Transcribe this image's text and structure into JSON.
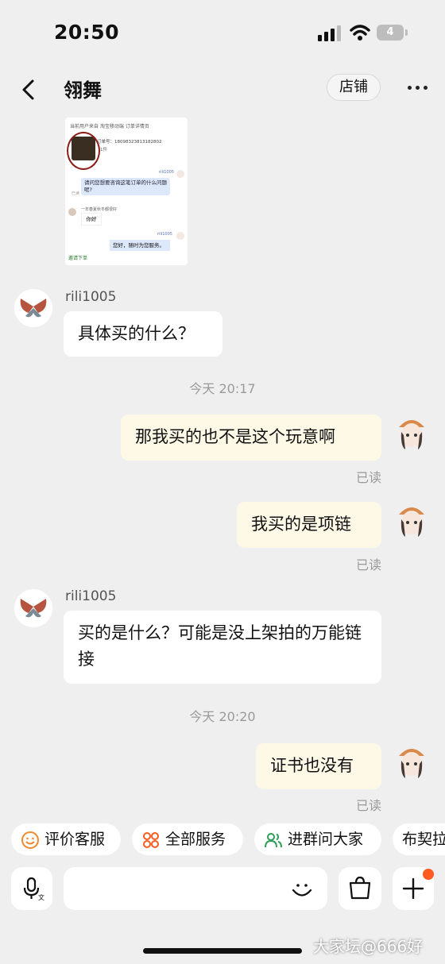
{
  "status_bar": {
    "time": "20:50",
    "battery": "4"
  },
  "header": {
    "title": "翎舞",
    "shop_label": "店铺"
  },
  "screenshot_preview": {
    "top_line": "当前用户来自 淘宝移动端 订单详情页",
    "order_line": "订单号：1809832381318280​2",
    "qty": "1件",
    "agent_name": "rili1005",
    "agent_question": "请问您想要咨询这笔订单的什么问题呢?",
    "read_label": "已读",
    "customer_name": "一年春夏秋冬都很好",
    "customer_msg": "你好",
    "agent_reply": "您好，随时为您服务。",
    "bottom_link": "邀请下单"
  },
  "messages": [
    {
      "sender": "rili1005",
      "text": "具体买的什么？"
    },
    {
      "timestamp": "今天 20:17"
    },
    {
      "text": "那我买的也不是这个玩意啊",
      "status": "已读"
    },
    {
      "text": "我买的是项链",
      "status": "已读"
    },
    {
      "sender": "rili1005",
      "text": "买的是什么？可能是没上架拍的万能链接"
    },
    {
      "timestamp": "今天 20:20"
    },
    {
      "text": "证书也没有",
      "status": "已读"
    }
  ],
  "quick_actions": [
    "评价客服",
    "全部服务",
    "进群问大家",
    "布契拉"
  ],
  "colors": {
    "accent": "#ff5a1f",
    "outgoing_bubble": "#fdf9e6",
    "incoming_bubble": "#ffffff",
    "background": "#efefef"
  },
  "watermark": "大家坛@666好"
}
